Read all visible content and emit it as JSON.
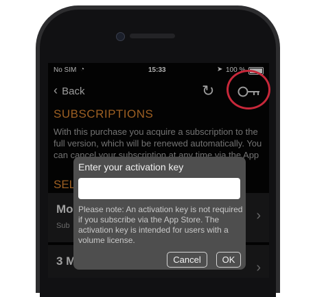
{
  "status_bar": {
    "carrier": "No SIM",
    "time": "15:33",
    "battery": "100 %",
    "wifi_icon": "wifi-icon",
    "location_icon": "location-arrow-icon"
  },
  "nav": {
    "back_label": "Back",
    "refresh_icon": "refresh-icon",
    "key_icon": "key-icon"
  },
  "subscriptions": {
    "title": "SUBSCRIPTIONS",
    "text": "With this purchase you acquire a subscription to the full version, which will be renewed automatically. You can cancel your subscription at any time via the App"
  },
  "select_label": "SEL",
  "rows": [
    {
      "title": "Mo",
      "subtitle": "Sub"
    },
    {
      "title": "3 M",
      "subtitle": ""
    }
  ],
  "dialog": {
    "title": "Enter your activation key",
    "input_value": "",
    "note": "Please note: An activation key is not required if you subscribe via the App Store. The activation key is intended for users with a volume license.",
    "cancel_label": "Cancel",
    "ok_label": "OK"
  },
  "colors": {
    "accent": "#d17f2e",
    "highlight_circle": "#c8283a"
  }
}
